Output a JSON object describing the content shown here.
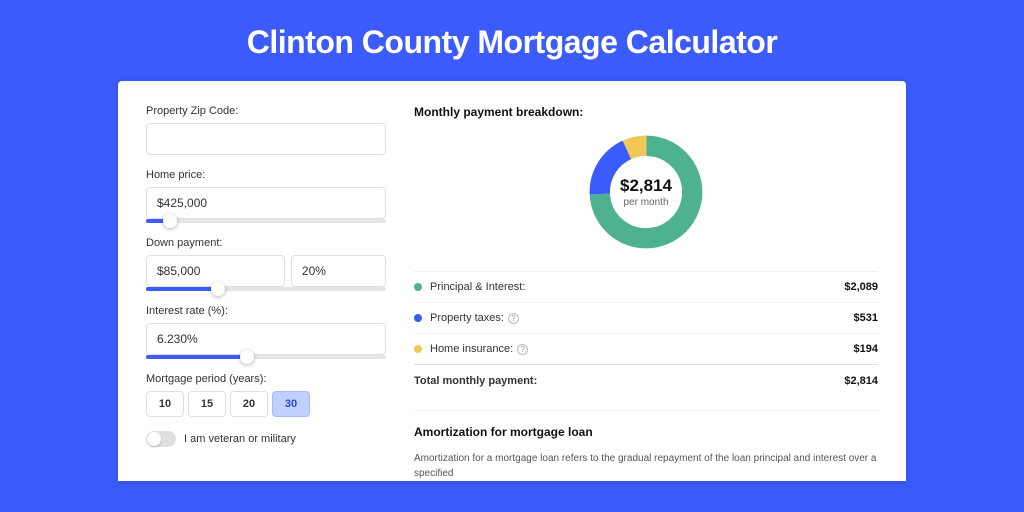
{
  "title": "Clinton County Mortgage Calculator",
  "form": {
    "zip": {
      "label": "Property Zip Code:",
      "value": ""
    },
    "home_price": {
      "label": "Home price:",
      "value": "$425,000",
      "slider_fill_pct": 10,
      "slider_thumb_pct": 10
    },
    "down_payment": {
      "label": "Down payment:",
      "amount": "$85,000",
      "percent": "20%",
      "slider_fill_pct": 30,
      "slider_thumb_pct": 30
    },
    "interest_rate": {
      "label": "Interest rate (%):",
      "value": "6.230%",
      "slider_fill_pct": 42,
      "slider_thumb_pct": 42
    },
    "period": {
      "label": "Mortgage period (years):",
      "options": [
        "10",
        "15",
        "20",
        "30"
      ],
      "selected": "30"
    },
    "veteran": {
      "label": "I am veteran or military",
      "checked": false
    }
  },
  "breakdown": {
    "title": "Monthly payment breakdown:",
    "center_amount": "$2,814",
    "center_sub": "per month",
    "rows": [
      {
        "color": "#4fb28f",
        "label": "Principal & Interest:",
        "help": false,
        "value": "$2,089"
      },
      {
        "color": "#3b5bfd",
        "label": "Property taxes:",
        "help": true,
        "value": "$531"
      },
      {
        "color": "#f0c855",
        "label": "Home insurance:",
        "help": true,
        "value": "$194"
      }
    ],
    "total": {
      "label": "Total monthly payment:",
      "value": "$2,814"
    }
  },
  "chart_data": {
    "type": "pie",
    "title": "Monthly payment breakdown",
    "series": [
      {
        "name": "Principal & Interest",
        "value": 2089,
        "color": "#4fb28f"
      },
      {
        "name": "Property taxes",
        "value": 531,
        "color": "#3b5bfd"
      },
      {
        "name": "Home insurance",
        "value": 194,
        "color": "#f0c855"
      }
    ],
    "total": 2814,
    "center_label": "$2,814 per month"
  },
  "amortization": {
    "title": "Amortization for mortgage loan",
    "text": "Amortization for a mortgage loan refers to the gradual repayment of the loan principal and interest over a specified"
  }
}
